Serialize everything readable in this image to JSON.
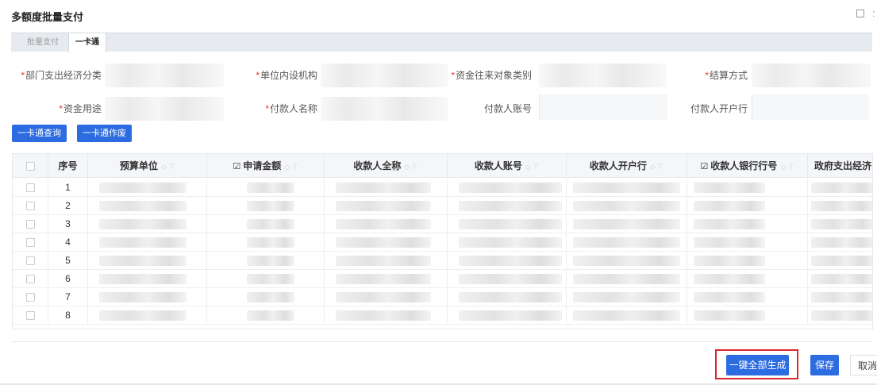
{
  "dialog": {
    "title": "多额度批量支付"
  },
  "tabs": [
    {
      "label": "批量支付"
    },
    {
      "label": "一卡通"
    }
  ],
  "form": {
    "dept_expense_class": "部门支出经济分类",
    "internal_org": "单位内设机构",
    "counterparty_type": "资金往来对象类别",
    "settle_method": "结算方式",
    "fund_use": "资金用途",
    "payer_name": "付款人名称",
    "payer_account": "付款人账号",
    "payer_bank": "付款人开户行",
    "required_mark": "*"
  },
  "actions": {
    "query": "一卡通查询",
    "void": "一卡通作废"
  },
  "table": {
    "columns": [
      {
        "label": "序号"
      },
      {
        "label": "预算单位"
      },
      {
        "label": "申请金额"
      },
      {
        "label": "收款人全称"
      },
      {
        "label": "收款人账号"
      },
      {
        "label": "收款人开户行"
      },
      {
        "label": "收款人银行行号"
      },
      {
        "label": "政府支出经济"
      }
    ],
    "rows": [
      {
        "no": "1",
        "unit": "",
        "amount": "",
        "payee": "",
        "account": "",
        "bank": "",
        "bank_code": "",
        "gov_class": ""
      },
      {
        "no": "2",
        "unit": "",
        "amount": "",
        "payee": "",
        "account": "",
        "bank": "",
        "bank_code": "",
        "gov_class": ""
      },
      {
        "no": "3",
        "unit": "",
        "amount": "",
        "payee": "",
        "account": "",
        "bank": "",
        "bank_code": "",
        "gov_class": ""
      },
      {
        "no": "4",
        "unit": "",
        "amount": "",
        "payee": "",
        "account": "",
        "bank": "",
        "bank_code": "",
        "gov_class": ""
      },
      {
        "no": "5",
        "unit": "",
        "amount": "",
        "payee": "",
        "account": "",
        "bank": "",
        "bank_code": "",
        "gov_class": ""
      },
      {
        "no": "6",
        "unit": "",
        "amount": "",
        "payee": "",
        "account": "",
        "bank": "",
        "bank_code": "",
        "gov_class": ""
      },
      {
        "no": "7",
        "unit": "",
        "amount": "",
        "payee": "",
        "account": "",
        "bank": "",
        "bank_code": "",
        "gov_class": ""
      },
      {
        "no": "8",
        "unit": "",
        "amount": "",
        "payee": "",
        "account": "",
        "bank": "",
        "bank_code": "",
        "gov_class": ""
      }
    ]
  },
  "footer": {
    "generate_all": "一键全部生成",
    "save": "保存",
    "cancel": "取消"
  },
  "colors": {
    "primary": "#2c6ce0",
    "highlight": "#d8282f",
    "required": "#e5383b"
  }
}
